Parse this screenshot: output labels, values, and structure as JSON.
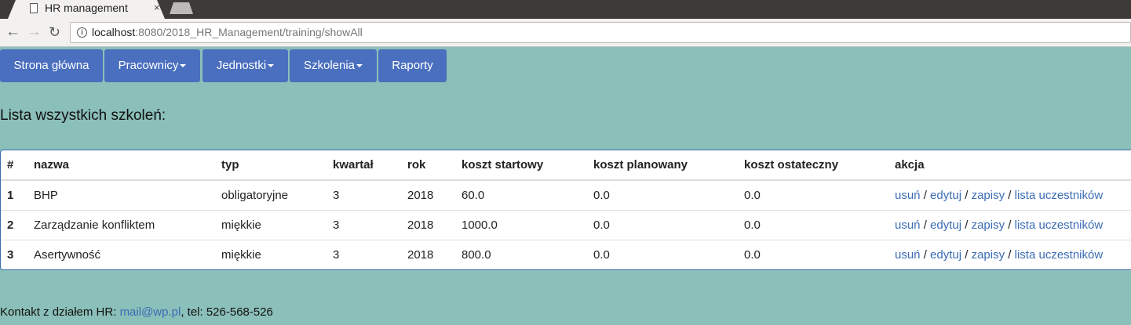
{
  "browser": {
    "tab_title": "HR management",
    "tab_close": "×",
    "url_host": "localhost",
    "url_rest": ":8080/2018_HR_Management/training/showAll"
  },
  "navbar": {
    "home": "Strona główna",
    "employees": "Pracownicy",
    "units": "Jednostki",
    "trainings": "Szkolenia",
    "reports": "Raporty"
  },
  "heading": "Lista wszystkich szkoleń:",
  "table": {
    "headers": [
      "#",
      "nazwa",
      "typ",
      "kwartał",
      "rok",
      "koszt startowy",
      "koszt planowany",
      "koszt ostateczny",
      "akcja"
    ],
    "rows": [
      {
        "id": "1",
        "name": "BHP",
        "type": "obligatoryjne",
        "quarter": "3",
        "year": "2018",
        "start_cost": "60.0",
        "planned_cost": "0.0",
        "final_cost": "0.0"
      },
      {
        "id": "2",
        "name": "Zarządzanie konfliktem",
        "type": "miękkie",
        "quarter": "3",
        "year": "2018",
        "start_cost": "1000.0",
        "planned_cost": "0.0",
        "final_cost": "0.0"
      },
      {
        "id": "3",
        "name": "Asertywność",
        "type": "miękkie",
        "quarter": "3",
        "year": "2018",
        "start_cost": "800.0",
        "planned_cost": "0.0",
        "final_cost": "0.0"
      }
    ],
    "actions": {
      "delete": "usuń",
      "edit": "edytuj",
      "enrollments": "zapisy",
      "participants": "lista uczestników",
      "sep": " / "
    }
  },
  "footer": {
    "prefix": "Kontakt z działem HR: ",
    "email": "mail@wp.pl",
    "suffix": ", tel: 526-568-526"
  }
}
